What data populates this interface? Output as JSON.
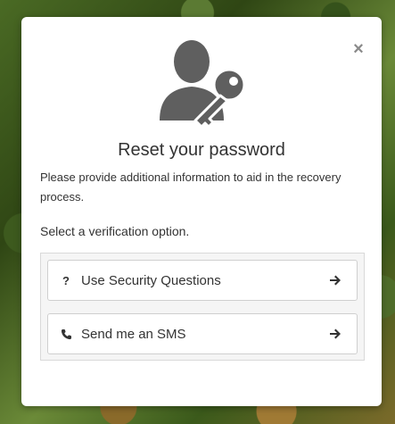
{
  "modal": {
    "close_symbol": "×",
    "title": "Reset your password",
    "description": "Please provide additional information to aid in the recovery process.",
    "select_label": "Select a verification option.",
    "hero_icon": "user-key-icon",
    "colors": {
      "icon_gray": "#5f5f5f",
      "text": "#333333",
      "options_bg": "#f5f5f5"
    }
  },
  "options": [
    {
      "label": "Use Security Questions",
      "icon_text": "?",
      "icon": "question-mark-icon",
      "arrow": "arrow-right-icon"
    },
    {
      "label": "Send me an SMS",
      "icon": "phone-icon",
      "arrow": "arrow-right-icon"
    }
  ]
}
